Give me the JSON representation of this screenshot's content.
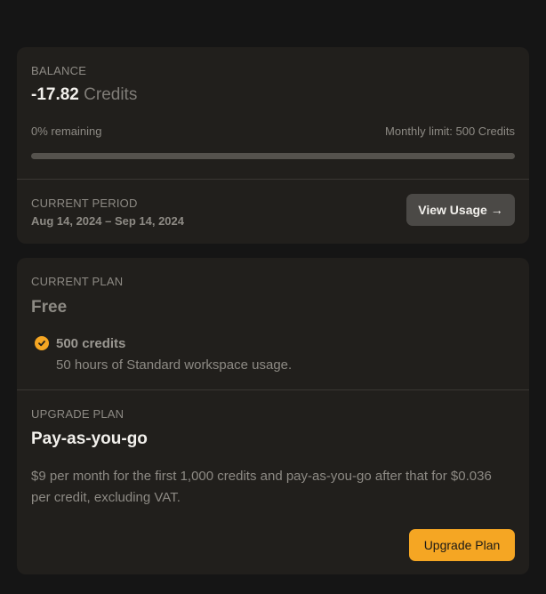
{
  "balance": {
    "label": "BALANCE",
    "value": "-17.82",
    "unit": "Credits",
    "remaining": "0% remaining",
    "limit": "Monthly limit: 500 Credits",
    "progress_fraction": 0.0
  },
  "period": {
    "label": "CURRENT PERIOD",
    "dates": "Aug 14, 2024 – Sep 14, 2024",
    "view_usage_label": "View Usage →"
  },
  "current_plan": {
    "label": "CURRENT PLAN",
    "name": "Free",
    "feature_title": "500 credits",
    "feature_desc": "50 hours of Standard workspace usage."
  },
  "upgrade_plan": {
    "label": "UPGRADE PLAN",
    "name": "Pay-as-you-go",
    "description": "$9 per month for the first 1,000 credits and pay-as-you-go after that for $0.036 per credit, excluding VAT.",
    "button_label": "Upgrade Plan"
  },
  "colors": {
    "accent": "#f5a623",
    "card_bg": "#211f1c",
    "page_bg": "#151515"
  },
  "icons": {
    "feature_check": "check-circle-icon"
  }
}
